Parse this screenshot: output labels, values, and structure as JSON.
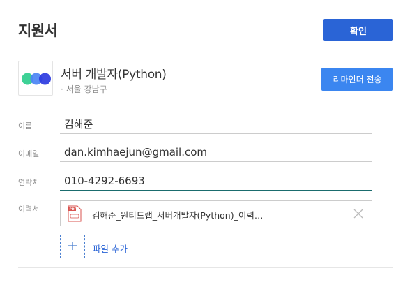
{
  "header": {
    "title": "지원서",
    "confirm_label": "확인"
  },
  "job": {
    "title": "서버 개발자(Python)",
    "location": "· 서울 강남구",
    "reminder_label": "리마인더 전송",
    "logo_colors": [
      "#3ed196",
      "#4b84f4",
      "#2d3be0"
    ]
  },
  "form": {
    "name_label": "이름",
    "name_value": "김해준",
    "email_label": "이메일",
    "email_value": "dan.kimhaejun@gmail.com",
    "phone_label": "연락처",
    "phone_value": "010-4292-6693",
    "resume_label": "이력서",
    "resume_file": "김해준_원티드랩_서버개발자(Python)_이력…",
    "add_file_label": "파일 추가"
  },
  "colors": {
    "primary": "#2a64d6",
    "reminder": "#3b86f0",
    "active_underline": "#1a6c6e"
  }
}
